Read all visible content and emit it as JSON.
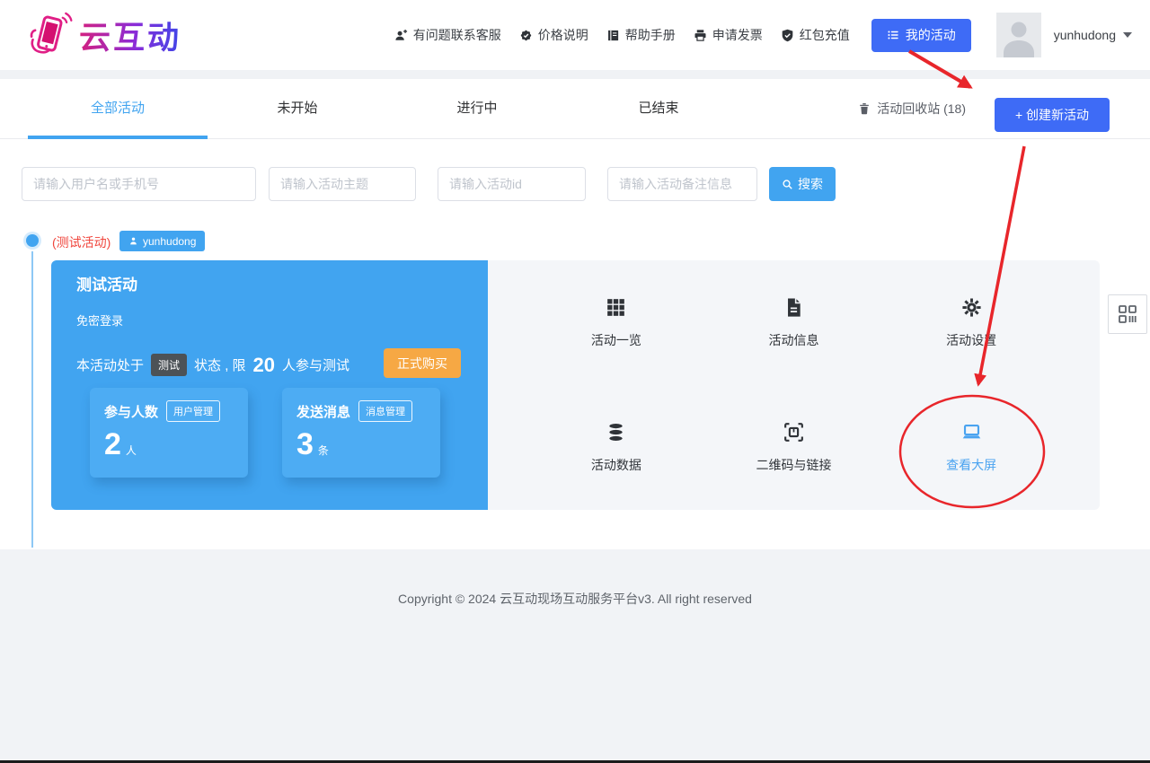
{
  "header": {
    "logo_text": "云互动",
    "nav": [
      {
        "label": "有问题联系客服",
        "icon": "person-add-icon"
      },
      {
        "label": "价格说明",
        "icon": "price-badge-icon"
      },
      {
        "label": "帮助手册",
        "icon": "book-icon"
      },
      {
        "label": "申请发票",
        "icon": "printer-icon"
      },
      {
        "label": "红包充值",
        "icon": "shield-check-icon"
      }
    ],
    "my_activities_button": "我的活动",
    "username": "yunhudong"
  },
  "tabs": {
    "items": [
      {
        "label": "全部活动",
        "active": true
      },
      {
        "label": "未开始",
        "active": false
      },
      {
        "label": "进行中",
        "active": false
      },
      {
        "label": "已结束",
        "active": false
      }
    ],
    "recycle_bin_label": "活动回收站 (18)",
    "create_button_label": "+ 创建新活动"
  },
  "search": {
    "placeholders": [
      "请输入用户名或手机号",
      "请输入活动主题",
      "请输入活动id",
      "请输入活动备注信息"
    ],
    "button_label": "搜索"
  },
  "activity": {
    "list_label": "(测试活动)",
    "owner_tag": "yunhudong",
    "title": "测试活动",
    "subtitle": "免密登录",
    "status_prefix": "本活动处于",
    "status_badge": "测试",
    "status_middle": "状态 , 限",
    "status_limit": "20",
    "status_suffix": "人参与测试",
    "buy_button": "正式购买",
    "stats": [
      {
        "label": "参与人数",
        "action": "用户管理",
        "value": "2",
        "unit": "人"
      },
      {
        "label": "发送消息",
        "action": "消息管理",
        "value": "3",
        "unit": "条"
      }
    ],
    "actions": [
      {
        "label": "活动一览",
        "icon": "grid-icon",
        "highlighted": false
      },
      {
        "label": "活动信息",
        "icon": "document-icon",
        "highlighted": false
      },
      {
        "label": "活动设置",
        "icon": "gear-icon",
        "highlighted": false
      },
      {
        "label": "活动数据",
        "icon": "database-icon",
        "highlighted": false
      },
      {
        "label": "二维码与链接",
        "icon": "qrcode-icon",
        "highlighted": false
      },
      {
        "label": "查看大屏",
        "icon": "monitor-icon",
        "highlighted": true
      }
    ]
  },
  "footer": {
    "copyright": "Copyright © 2024 云互动现场互动服务平台v3. All right reserved"
  },
  "colors": {
    "primary_blue": "#41a4f0",
    "button_blue": "#3e6bf6",
    "warning_orange": "#f6a844",
    "badge_dark": "#4c5257",
    "label_red": "#f0453c",
    "annotation_red": "#e8262b"
  }
}
